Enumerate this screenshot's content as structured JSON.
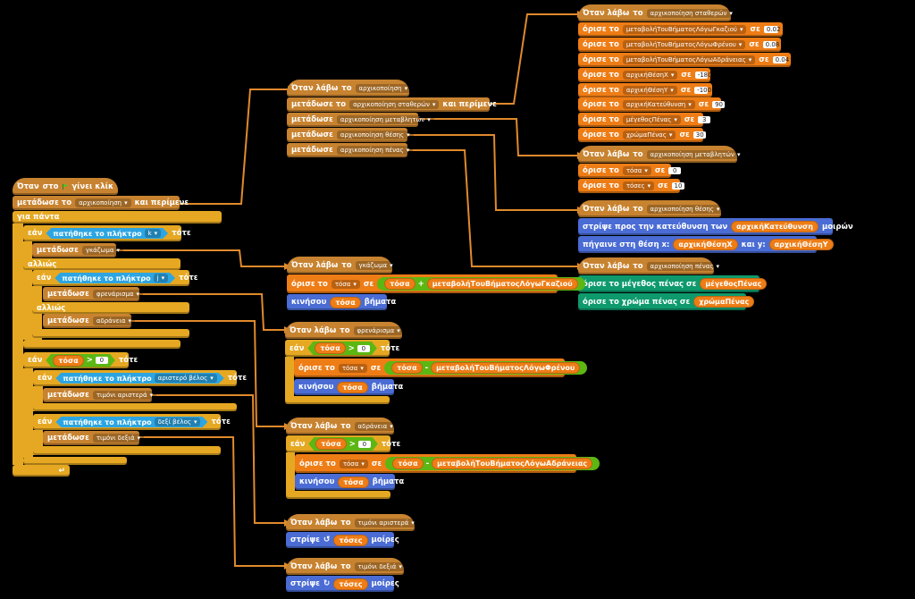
{
  "colors": {
    "background": "#000000",
    "events": "#c88330",
    "control": "#e6a822",
    "sensing": "#2ca5e2",
    "operators": "#5cb712",
    "variables": "#ee7d16",
    "motion": "#4a6cd4",
    "pen": "#0e9a6c",
    "wire": "#e08a2c"
  },
  "labels": {
    "when_receive": "Όταν λάβω",
    "to": "το",
    "broadcast": "μετάδωσε",
    "broadcast_wait_to": "μετάδωσε το",
    "and_wait": "και περίμενε",
    "set": "όρισε",
    "set_to": "όρισε το",
    "in": "σε",
    "when": "Όταν",
    "at": "στο",
    "clicked": "γίνει κλίκ",
    "forever": "για πάντα",
    "if": "εάν",
    "then": "τότε",
    "else": "αλλιώς",
    "key_pressed": "πατήθηκε το πλήκτρο",
    "move": "κινήσου",
    "steps": "βήματα",
    "turn": "στρίψε",
    "degrees": "μοίρες",
    "point_towards": "στρίψε προς την κατεύθυνση των",
    "degrees2": "μοιρών",
    "goto_x": "πήγαινε στη θέση x:",
    "and_y": "και y:",
    "set_pen_size": "όρισε το μέγεθος πένας σε",
    "set_pen_color": "όρισε το χρώμα πένας σε",
    "gt": ">",
    "plus": "+",
    "minus": "-"
  },
  "messages": {
    "init": "αρχικοποίηση",
    "init_const": "αρχικοποίηση σταθερών",
    "init_vars": "αρχικοποίηση μεταβλητών",
    "init_pos": "αρχικοποίηση θέσης",
    "init_pen": "αρχικοποίηση πένας",
    "accel": "γκάζωμα",
    "brake": "φρενάρισμα",
    "inertia": "αδράνεια",
    "steer_left": "τιμόνι αριστερά",
    "steer_right": "τιμόνι δεξιά"
  },
  "keys": {
    "k": "k",
    "j": "j",
    "left": "αριστερό βέλος",
    "right": "δεξί βέλος"
  },
  "variables": {
    "rate_gas": "μεταβολήΤουΒήματοςΛόγωΓκαζιού",
    "rate_brake": "μεταβολήΤουΒήματοςΛόγωΦρένου",
    "rate_inertia": "μεταβολήΤουΒήματοςΛόγωΑδράνειας",
    "startX": "αρχικήΘέσηX",
    "startY": "αρχικήΘέσηY",
    "startDir": "αρχικήΚατεύθυνση",
    "penSize": "μέγεθοςΠένας",
    "penColor": "χρώμαΠένας",
    "tosa": "τόσα",
    "toses": "τόσες"
  },
  "values": {
    "rate_gas": "0.02",
    "rate_brake": "0.08",
    "rate_inertia": "0.04",
    "startX": "-180",
    "startY": "-100",
    "startDir": "90",
    "penSize": "3",
    "penColor": "30",
    "zero": "0",
    "ten": "10"
  }
}
